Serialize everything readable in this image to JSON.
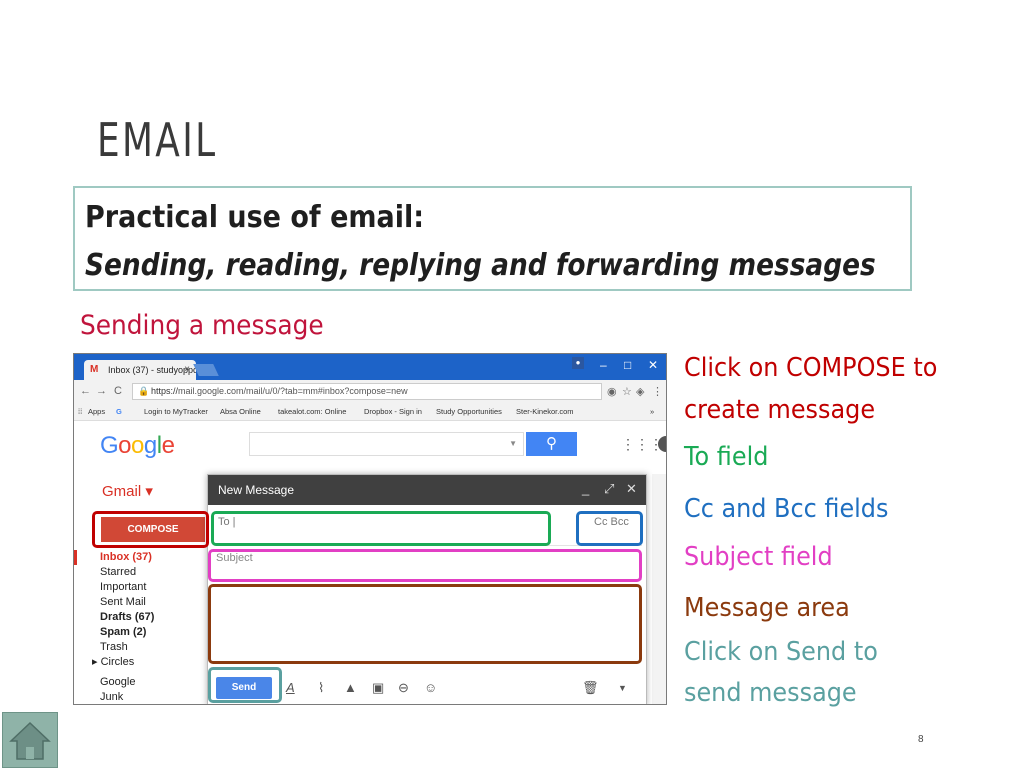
{
  "slide": {
    "title": "EMAIL",
    "heading_line1": "Practical use of email:",
    "heading_line2": "Sending, reading, replying and forwarding messages",
    "section_label": "Sending a message",
    "page_number": "8"
  },
  "browser": {
    "tab_title": "Inbox (37) - studyoppor",
    "tab_close": "×",
    "url_https": "https://",
    "url_rest": "mail.google.com/mail/u/0/?tab=mm#inbox?compose=new",
    "bookmarks": [
      "Apps",
      "G",
      "Login to MyTracker",
      "Absa Online",
      "takealot.com: Online",
      "Dropbox - Sign in",
      "Study Opportunities",
      "Ster-Kinekor.com"
    ],
    "bookmarks_more": "»"
  },
  "gmail": {
    "logo_letters": [
      "G",
      "o",
      "o",
      "g",
      "l",
      "e"
    ],
    "logo_colors": [
      "#4285f4",
      "#ea4335",
      "#fbbc05",
      "#4285f4",
      "#34a853",
      "#ea4335"
    ],
    "label": "Gmail ▾",
    "compose_label": "COMPOSE",
    "folders": {
      "inbox": "Inbox (37)",
      "starred": "Starred",
      "important": "Important",
      "sent": "Sent Mail",
      "drafts": "Drafts (67)",
      "spam": "Spam (2)",
      "trash": "Trash",
      "circles": "▸ Circles",
      "google": "Google",
      "junk": "Junk"
    }
  },
  "compose": {
    "title": "New Message",
    "to_label": "To |",
    "cc_bcc_label": "Cc  Bcc",
    "subject_placeholder": "Subject",
    "send_label": "Send"
  },
  "annotations": {
    "compose_line1": "Click on COMPOSE to",
    "compose_line2": "create message",
    "to_field": "To field",
    "cc_bcc": "Cc and Bcc fields",
    "subject": "Subject field",
    "message_area": "Message area",
    "send_line1": "Click on Send to",
    "send_line2": "send message"
  },
  "colors": {
    "compose_annotation": "#c00000",
    "to_annotation": "#1aaa55",
    "cc_bcc_annotation": "#1f6fc0",
    "subject_annotation": "#e23fc4",
    "message_annotation": "#8b3a0e",
    "send_annotation": "#5aa0a0",
    "section_label": "#c0143c"
  }
}
